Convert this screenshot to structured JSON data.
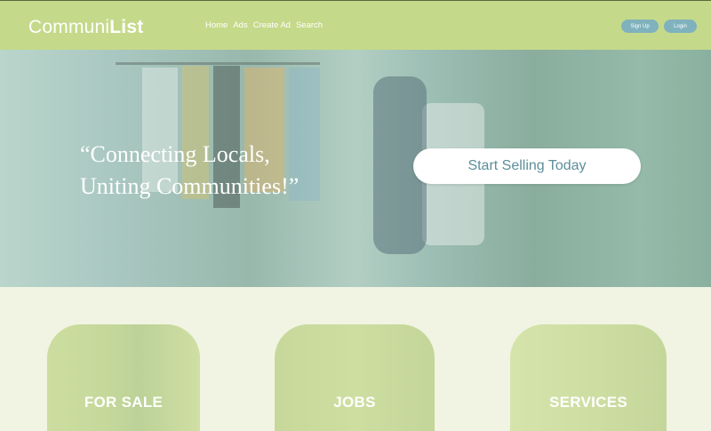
{
  "brand": {
    "logo_light": "Communi",
    "logo_bold": "List"
  },
  "nav": {
    "items": [
      "Home",
      "Ads",
      "Create Ad",
      "Search"
    ]
  },
  "auth": {
    "signup": "Sign Up",
    "login": "Login"
  },
  "hero": {
    "quote_line1": "“Connecting Locals,",
    "quote_line2": "Uniting Communities!”",
    "cta": "Start Selling Today"
  },
  "categories": [
    {
      "label": "FOR SALE"
    },
    {
      "label": "JOBS"
    },
    {
      "label": "SERVICES"
    }
  ],
  "colors": {
    "nav_bg": "#c5d98a",
    "button": "#7fb2bd",
    "page_bg": "#f1f4e2",
    "cta_text": "#5c8f9a"
  }
}
